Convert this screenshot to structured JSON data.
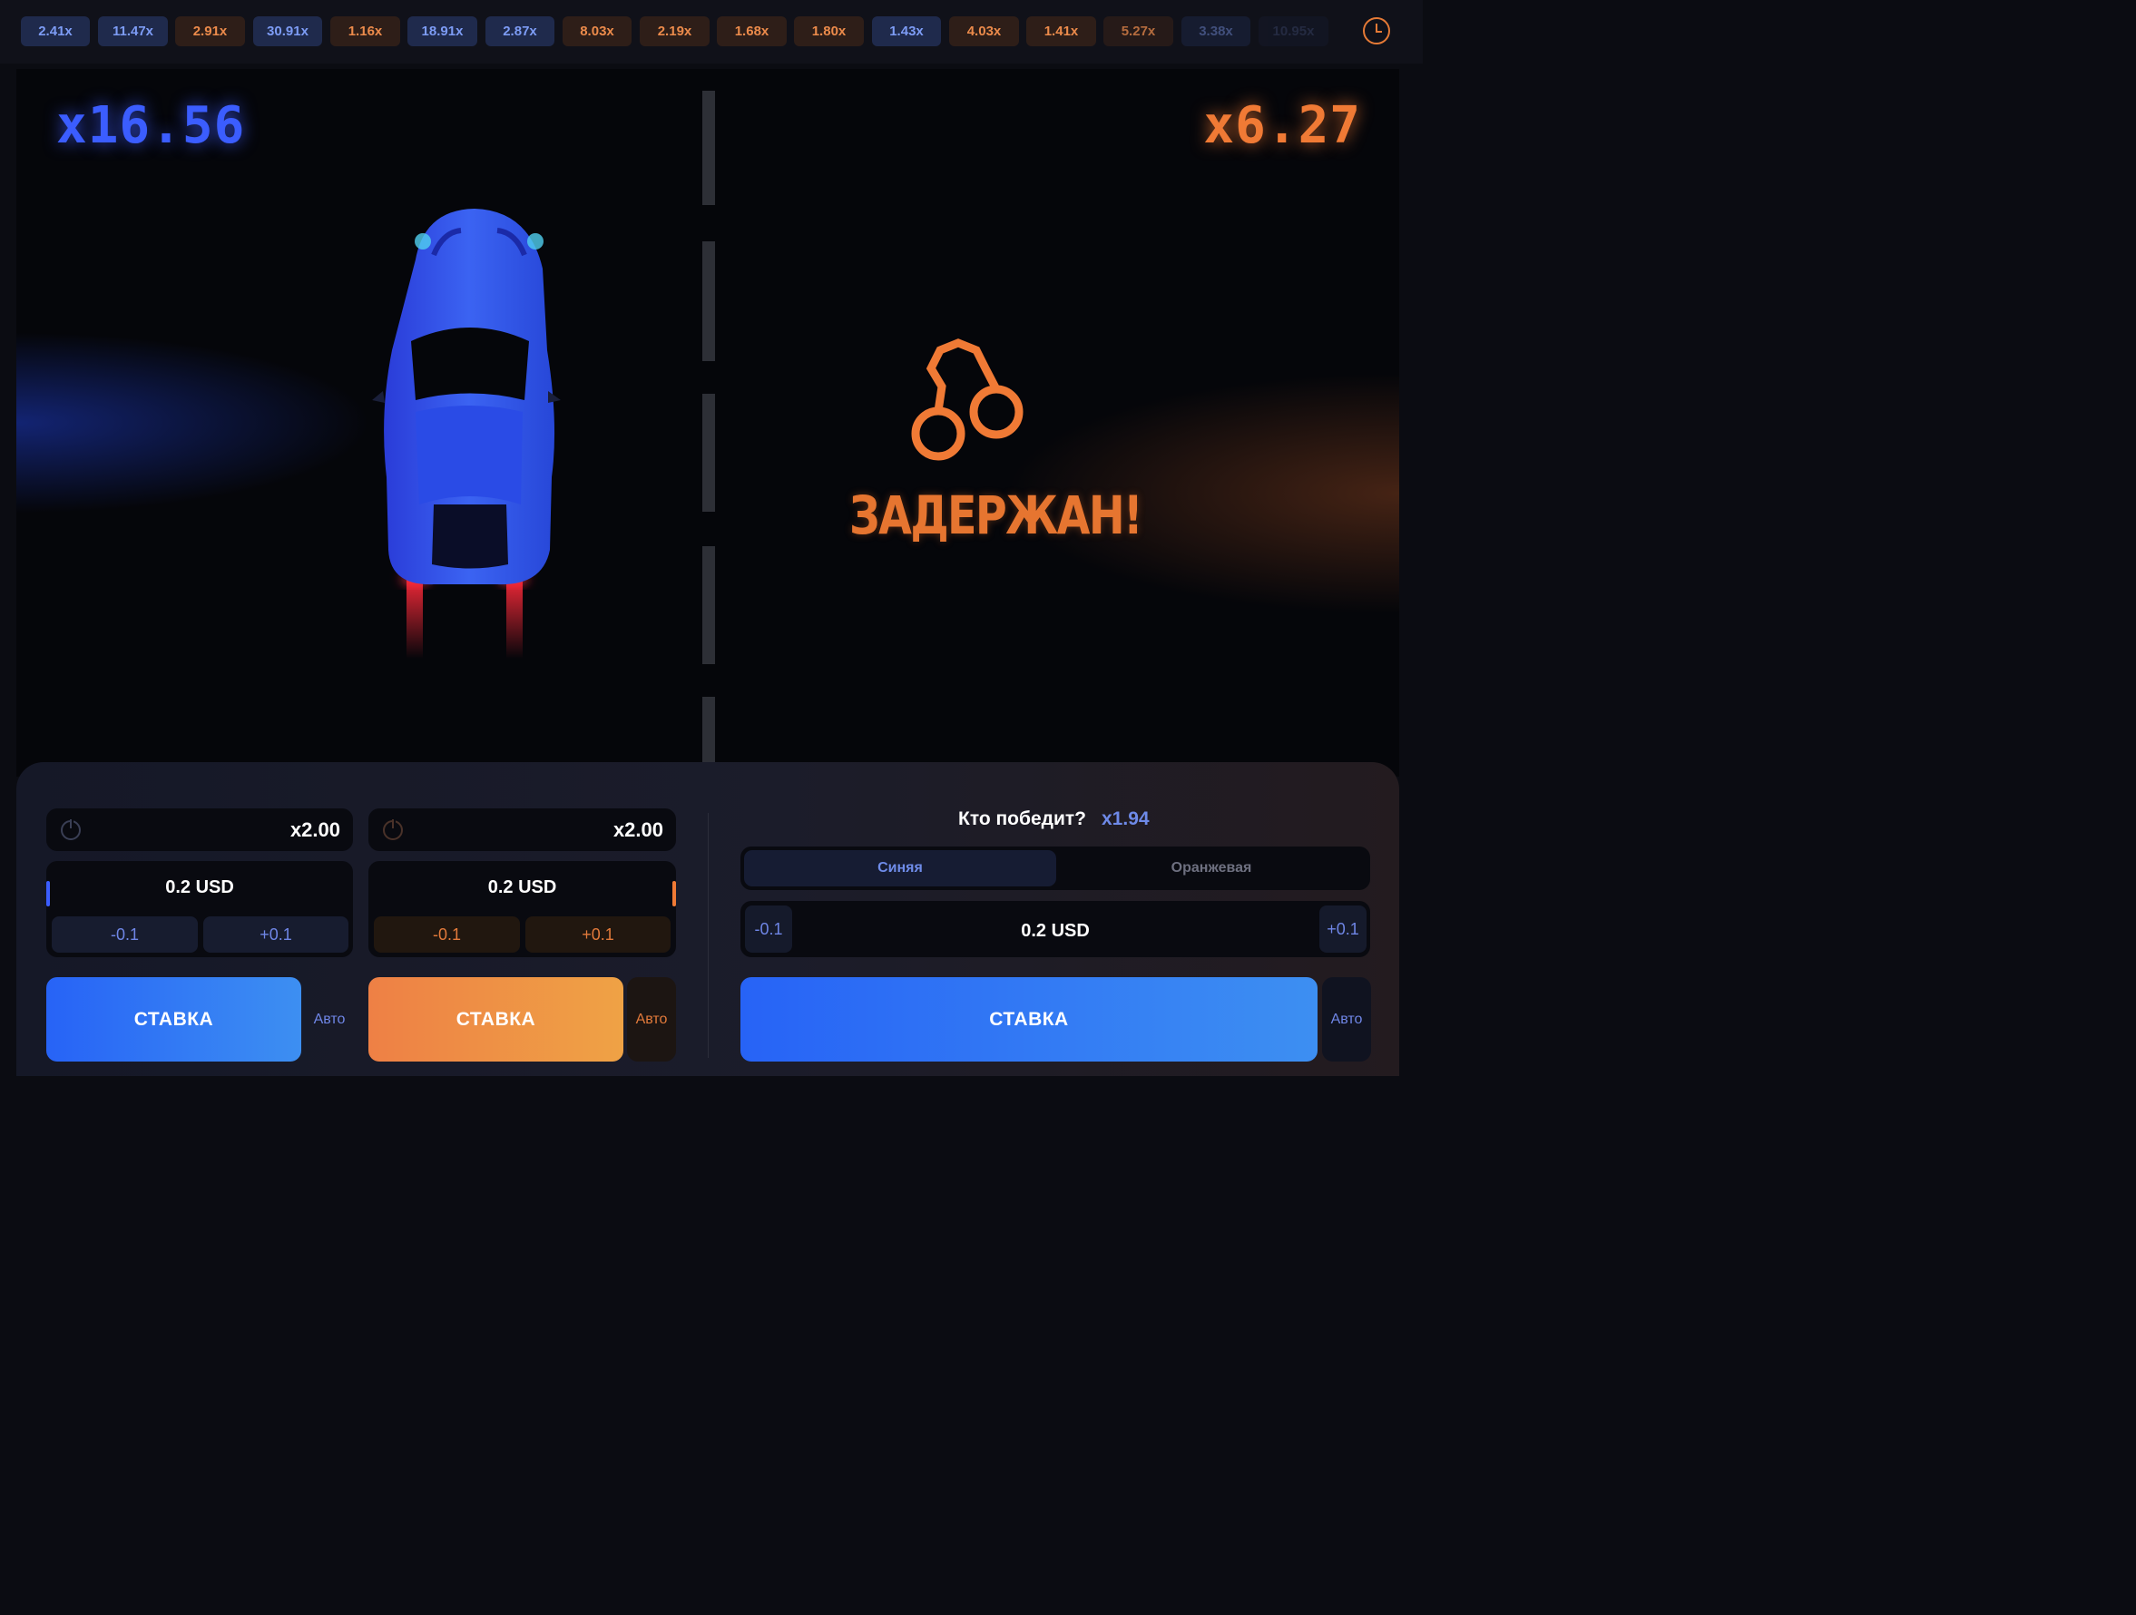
{
  "history": {
    "chips": [
      {
        "value": "2.41x",
        "color": "blue"
      },
      {
        "value": "11.47x",
        "color": "blue"
      },
      {
        "value": "2.91x",
        "color": "orange"
      },
      {
        "value": "30.91x",
        "color": "blue"
      },
      {
        "value": "1.16x",
        "color": "orange"
      },
      {
        "value": "18.91x",
        "color": "blue"
      },
      {
        "value": "2.87x",
        "color": "blue"
      },
      {
        "value": "8.03x",
        "color": "orange"
      },
      {
        "value": "2.19x",
        "color": "orange"
      },
      {
        "value": "1.68x",
        "color": "orange"
      },
      {
        "value": "1.80x",
        "color": "orange"
      },
      {
        "value": "1.43x",
        "color": "blue"
      },
      {
        "value": "4.03x",
        "color": "orange"
      },
      {
        "value": "1.41x",
        "color": "orange"
      },
      {
        "value": "5.27x",
        "color": "orange"
      },
      {
        "value": "3.38x",
        "color": "blue"
      },
      {
        "value": "10.95x",
        "color": "blue"
      }
    ],
    "history_icon": "clock-icon"
  },
  "game": {
    "blue_multiplier": "x16.56",
    "orange_multiplier": "x6.27",
    "orange_status": "ЗАДЕРЖАН!",
    "orange_status_icon": "handcuffs-icon",
    "colors": {
      "blue": "#3b5dff",
      "orange": "#f07a35"
    }
  },
  "bet_blue": {
    "autocashout": "x2.00",
    "amount": "0.2 USD",
    "minus": "-0.1",
    "plus": "+0.1",
    "bet_label": "СТАВКА",
    "auto_label": "Авто"
  },
  "bet_orange": {
    "autocashout": "x2.00",
    "amount": "0.2 USD",
    "minus": "-0.1",
    "plus": "+0.1",
    "bet_label": "СТАВКА",
    "auto_label": "Авто"
  },
  "winner_bet": {
    "question": "Кто победит?",
    "multiplier": "x1.94",
    "options": [
      "Синяя",
      "Оранжевая"
    ],
    "selected": "Синяя",
    "amount": "0.2 USD",
    "minus": "-0.1",
    "plus": "+0.1",
    "bet_label": "СТАВКА",
    "auto_label": "Авто"
  }
}
